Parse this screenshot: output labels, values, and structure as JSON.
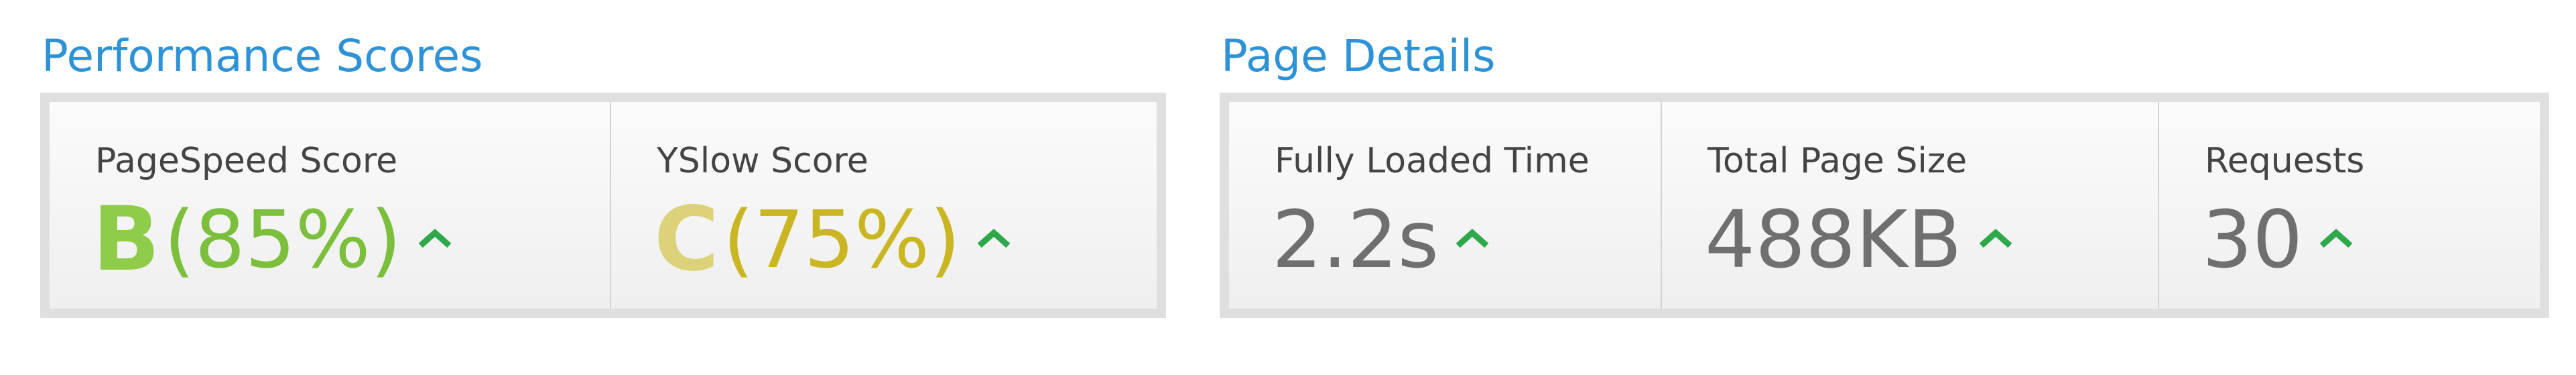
{
  "performance": {
    "title": "Performance Scores",
    "pagespeed": {
      "label": "PageSpeed Score",
      "grade": "B",
      "percent": "(85%)",
      "color": "#7cbf3c",
      "trend_icon": "caret-up-icon"
    },
    "yslow": {
      "label": "YSlow Score",
      "grade": "C",
      "percent": "(75%)",
      "color": "#c9b622",
      "trend_icon": "caret-up-icon"
    }
  },
  "details": {
    "title": "Page Details",
    "load_time": {
      "label": "Fully Loaded Time",
      "value": "2.2s",
      "trend_icon": "caret-up-icon"
    },
    "page_size": {
      "label": "Total Page Size",
      "value": "488KB",
      "trend_icon": "caret-up-icon"
    },
    "requests": {
      "label": "Requests",
      "value": "30",
      "trend_icon": "caret-up-icon"
    }
  },
  "colors": {
    "title_blue": "#2e92d6",
    "trend_up_green": "#2ea84a",
    "value_gray": "#6f6f6f"
  }
}
